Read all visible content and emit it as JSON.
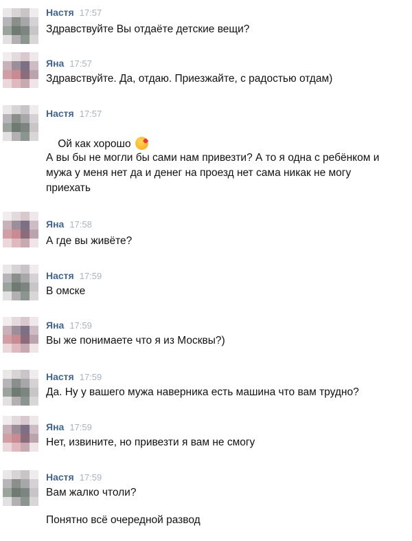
{
  "colors": {
    "author": "#42648b",
    "time": "#a9b3bf",
    "text": "#111111",
    "background": "#ffffff"
  },
  "messages": [
    {
      "author": "Настя",
      "time": "17:57",
      "lines": [
        "Здравствуйте Вы отдаёте детские вещи?"
      ]
    },
    {
      "author": "Яна",
      "time": "17:57",
      "lines": [
        "Здравствуйте. Да, отдаю. Приезжайте, с радостью отдам)"
      ]
    },
    {
      "author": "Настя",
      "time": "17:57",
      "lines": [
        "Ой как хорошо",
        "А вы бы не могли бы сами нам привезти? А то я одна с ребёнком и мужа у меня нет да и денег на проезд нет сама никак не могу приехать"
      ],
      "emoji": "kissing-heart-emoji"
    },
    {
      "author": "Яна",
      "time": "17:58",
      "lines": [
        "А где вы живёте?"
      ]
    },
    {
      "author": "Настя",
      "time": "17:59",
      "lines": [
        "В омске"
      ]
    },
    {
      "author": "Яна",
      "time": "17:59",
      "lines": [
        "Вы же понимаете что я из Москвы?)"
      ]
    },
    {
      "author": "Настя",
      "time": "17:59",
      "lines": [
        "Да. Ну у вашего мужа наверника есть машина что вам трудно?"
      ]
    },
    {
      "author": "Яна",
      "time": "17:59",
      "lines": [
        "Нет, извините, но привезти я вам не смогу"
      ]
    },
    {
      "author": "Настя",
      "time": "17:59",
      "lines": [
        "Вам жалко чтоли?",
        "Понятно всё очередной развод"
      ]
    }
  ]
}
